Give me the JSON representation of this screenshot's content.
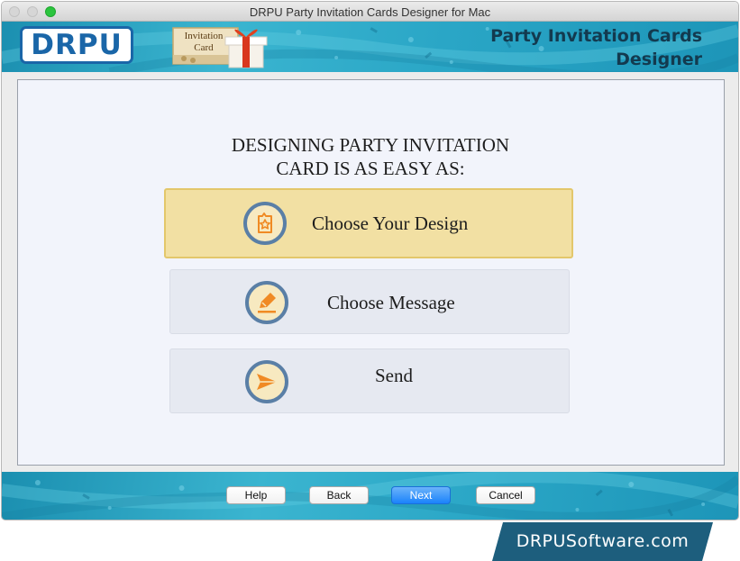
{
  "window": {
    "title": "DRPU Party Invitation Cards Designer for Mac"
  },
  "header": {
    "logo_text": "DRPU",
    "product_icon": {
      "name": "invitation-card-gift-icon",
      "card_line1": "Invitation",
      "card_line2": "Card"
    },
    "product_title_line1": "Party Invitation Cards",
    "product_title_line2": "Designer"
  },
  "main": {
    "heading_line1": "DESIGNING PARTY INVITATION",
    "heading_line2": "CARD IS AS EASY AS:",
    "steps": [
      {
        "label": "Choose Your Design",
        "icon": "star-card-icon",
        "active": true
      },
      {
        "label": "Choose Message",
        "icon": "pen-icon",
        "active": false
      },
      {
        "label": "Send",
        "icon": "paper-plane-icon",
        "active": false
      }
    ]
  },
  "footer": {
    "help_label": "Help",
    "back_label": "Back",
    "next_label": "Next",
    "cancel_label": "Cancel"
  },
  "watermark": "DRPUSoftware.com",
  "colors": {
    "header_teal": "#2aa6c6",
    "active_step_bg": "#f2e0a3",
    "icon_orange": "#f08a24",
    "icon_ring": "#5a7fa6",
    "next_button": "#1a82fb",
    "watermark_bg": "#1d5e7d"
  }
}
